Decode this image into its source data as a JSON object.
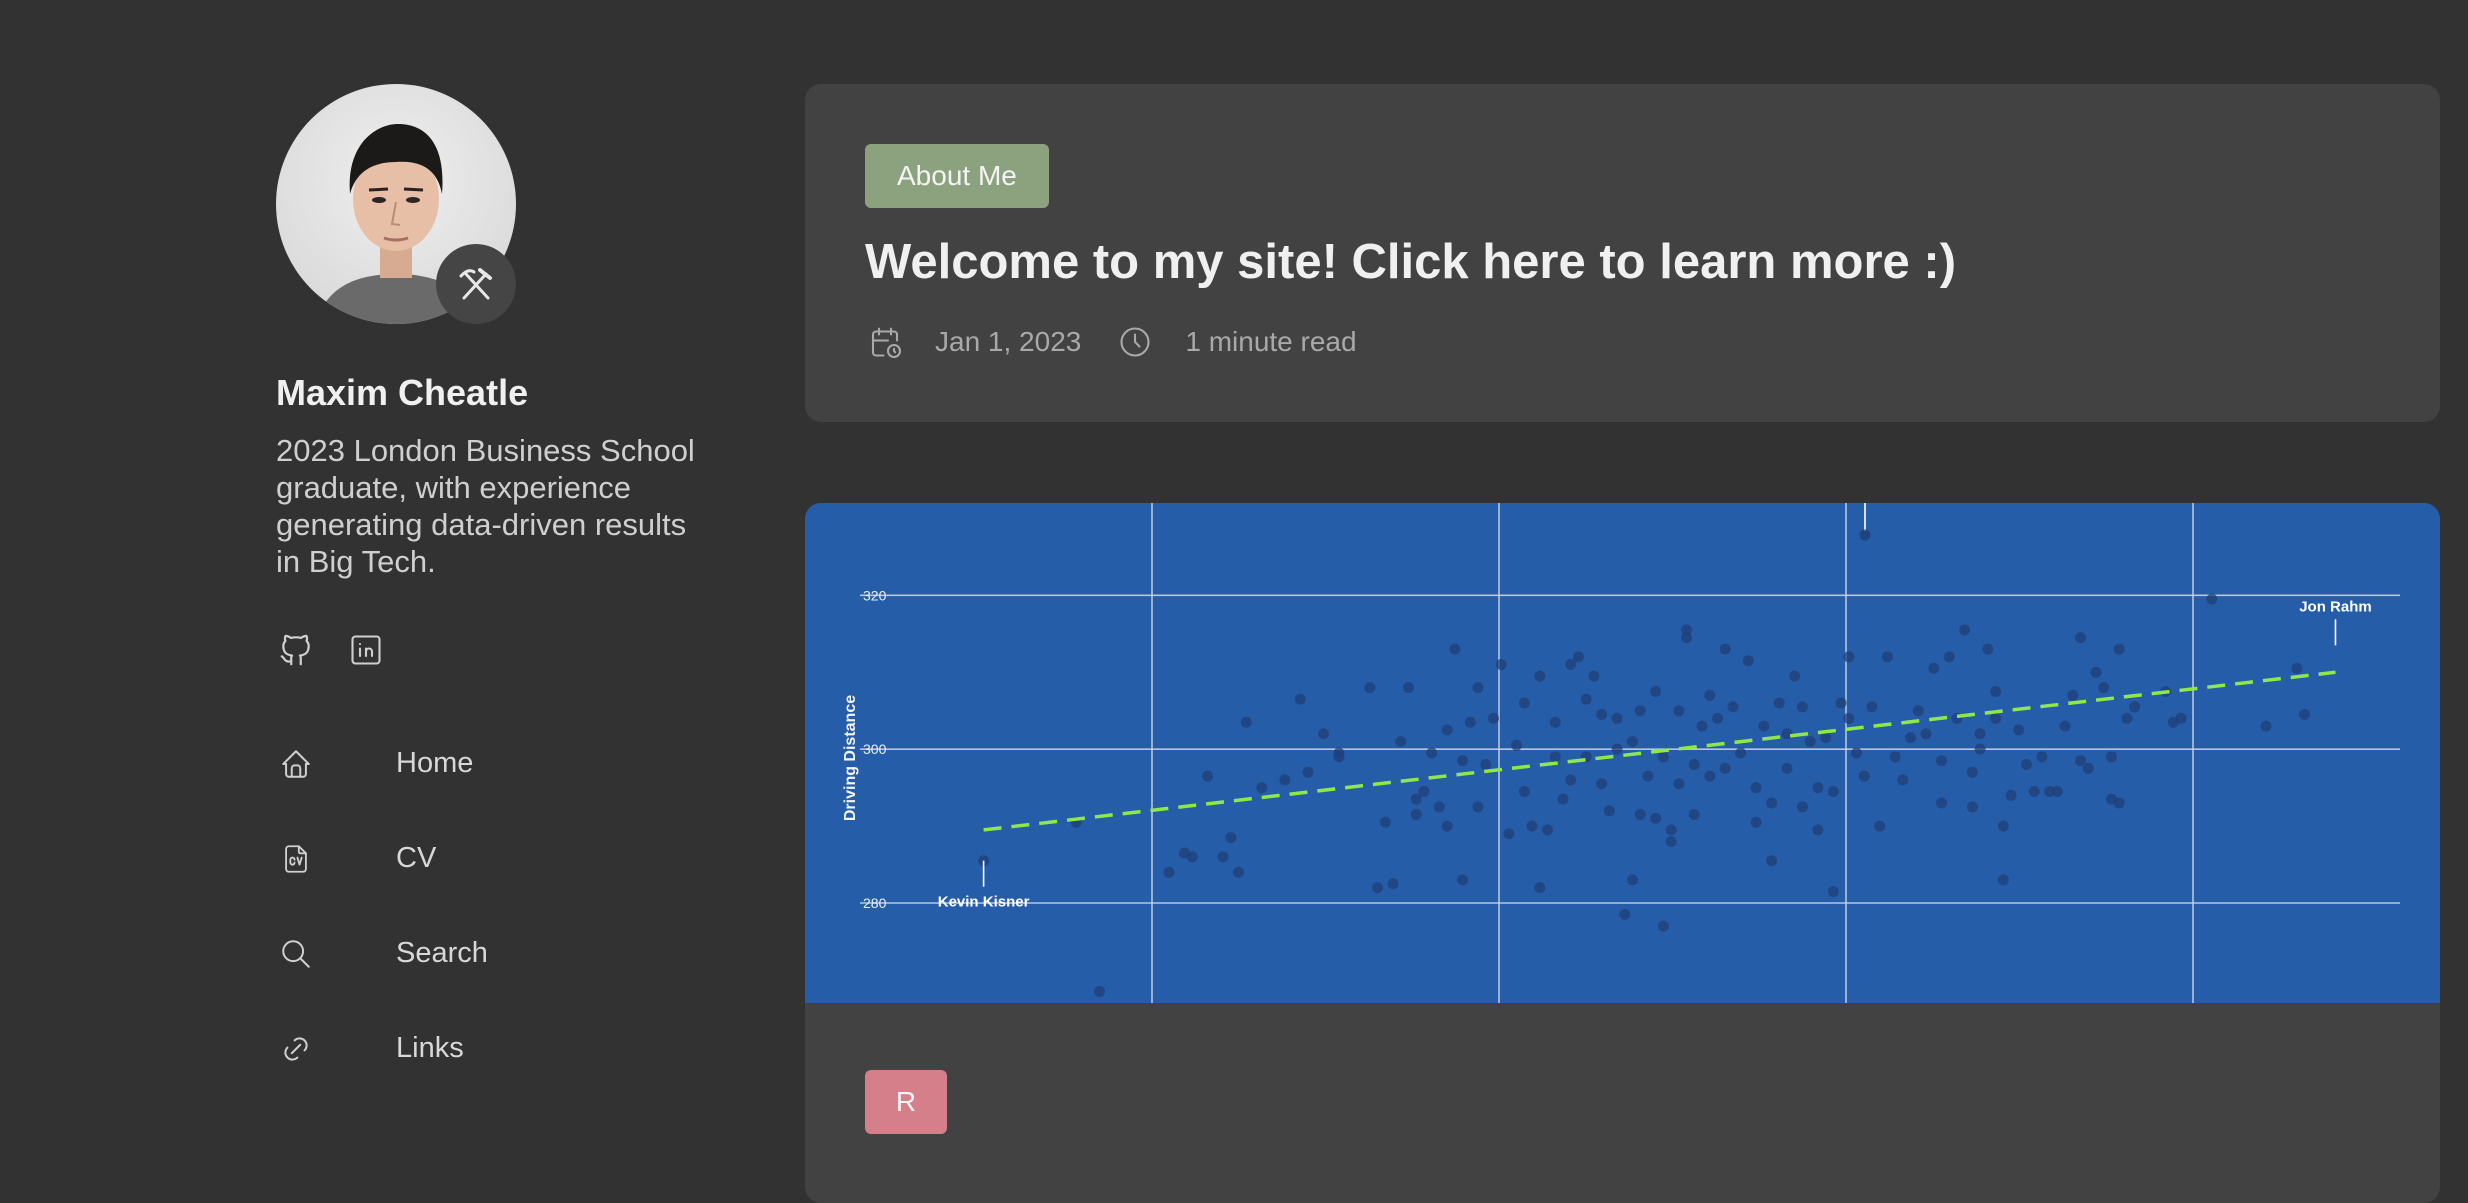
{
  "author": {
    "name": "Maxim Cheatle",
    "bio": "2023 London Business School graduate, with experience generating data-driven results in Big Tech.",
    "avatar_badge_icon": "hammer-pick-icon"
  },
  "social": [
    {
      "icon": "github-icon"
    },
    {
      "icon": "linkedin-icon"
    }
  ],
  "nav": {
    "items": [
      {
        "label": "Home",
        "icon": "home-icon"
      },
      {
        "label": "CV",
        "icon": "cv-file-icon"
      },
      {
        "label": "Search",
        "icon": "search-icon"
      },
      {
        "label": "Links",
        "icon": "link-icon"
      }
    ]
  },
  "post": {
    "tag": "About Me",
    "title": "Welcome to my site! Click here to learn more :)",
    "date": "Jan 1, 2023",
    "read_time": "1 minute read"
  },
  "post2": {
    "tag": "R"
  },
  "colors": {
    "background": "#323232",
    "card": "#424242",
    "tag_about": "#8ca27e",
    "tag_r": "#d47f89",
    "chart_bg": "#265da8",
    "trend_line": "#8fe84a"
  },
  "chart_data": {
    "type": "scatter",
    "ylabel": "Driving Distance",
    "ylim": [
      267,
      332
    ],
    "yticks": [
      280,
      300,
      320
    ],
    "xlim": [
      0,
      1
    ],
    "grid": true,
    "annotations": [
      {
        "label": "Kevin Kisner",
        "x": 0.08,
        "y": 285.5
      },
      {
        "label": "Jon Rahm",
        "x": 0.955,
        "y": 313.5
      }
    ],
    "trend": {
      "x": [
        0.08,
        0.955
      ],
      "y": [
        289.5,
        310
      ]
    },
    "points": [
      [
        0.08,
        285.5
      ],
      [
        0.14,
        290.5
      ],
      [
        0.155,
        268.5
      ],
      [
        0.2,
        284
      ],
      [
        0.21,
        286.5
      ],
      [
        0.215,
        286
      ],
      [
        0.225,
        296.5
      ],
      [
        0.235,
        286
      ],
      [
        0.24,
        288.5
      ],
      [
        0.245,
        284
      ],
      [
        0.25,
        303.5
      ],
      [
        0.26,
        295
      ],
      [
        0.275,
        296
      ],
      [
        0.285,
        306.5
      ],
      [
        0.29,
        297
      ],
      [
        0.3,
        302
      ],
      [
        0.31,
        299.5
      ],
      [
        0.31,
        299
      ],
      [
        0.33,
        308
      ],
      [
        0.335,
        282
      ],
      [
        0.34,
        290.5
      ],
      [
        0.345,
        282.5
      ],
      [
        0.35,
        301
      ],
      [
        0.355,
        308
      ],
      [
        0.36,
        291.5
      ],
      [
        0.36,
        293.5
      ],
      [
        0.365,
        294.5
      ],
      [
        0.37,
        299.5
      ],
      [
        0.375,
        292.5
      ],
      [
        0.38,
        290
      ],
      [
        0.38,
        302.5
      ],
      [
        0.385,
        313
      ],
      [
        0.39,
        298.5
      ],
      [
        0.39,
        283
      ],
      [
        0.395,
        303.5
      ],
      [
        0.4,
        308
      ],
      [
        0.4,
        292.5
      ],
      [
        0.405,
        298
      ],
      [
        0.41,
        304
      ],
      [
        0.415,
        311
      ],
      [
        0.42,
        289
      ],
      [
        0.425,
        300.5
      ],
      [
        0.43,
        306
      ],
      [
        0.43,
        294.5
      ],
      [
        0.435,
        290
      ],
      [
        0.44,
        282
      ],
      [
        0.44,
        309.5
      ],
      [
        0.445,
        289.5
      ],
      [
        0.45,
        303.5
      ],
      [
        0.45,
        299
      ],
      [
        0.455,
        293.5
      ],
      [
        0.46,
        311
      ],
      [
        0.46,
        296
      ],
      [
        0.465,
        312
      ],
      [
        0.47,
        306.5
      ],
      [
        0.47,
        299
      ],
      [
        0.475,
        309.5
      ],
      [
        0.48,
        295.5
      ],
      [
        0.48,
        304.5
      ],
      [
        0.485,
        292
      ],
      [
        0.49,
        300
      ],
      [
        0.49,
        304
      ],
      [
        0.495,
        278.5
      ],
      [
        0.5,
        283
      ],
      [
        0.5,
        301
      ],
      [
        0.505,
        305
      ],
      [
        0.505,
        291.5
      ],
      [
        0.51,
        296.5
      ],
      [
        0.515,
        291
      ],
      [
        0.515,
        307.5
      ],
      [
        0.52,
        277
      ],
      [
        0.52,
        299
      ],
      [
        0.525,
        288
      ],
      [
        0.525,
        289.5
      ],
      [
        0.53,
        305
      ],
      [
        0.53,
        295.5
      ],
      [
        0.535,
        315.5
      ],
      [
        0.535,
        314.5
      ],
      [
        0.54,
        291.5
      ],
      [
        0.54,
        298
      ],
      [
        0.545,
        303
      ],
      [
        0.55,
        307
      ],
      [
        0.55,
        296.5
      ],
      [
        0.555,
        304
      ],
      [
        0.56,
        313
      ],
      [
        0.56,
        297.5
      ],
      [
        0.565,
        305.5
      ],
      [
        0.57,
        299.5
      ],
      [
        0.575,
        311.5
      ],
      [
        0.58,
        295
      ],
      [
        0.58,
        290.5
      ],
      [
        0.585,
        303
      ],
      [
        0.59,
        293
      ],
      [
        0.59,
        285.5
      ],
      [
        0.595,
        306
      ],
      [
        0.6,
        302
      ],
      [
        0.6,
        297.5
      ],
      [
        0.605,
        309.5
      ],
      [
        0.61,
        292.5
      ],
      [
        0.61,
        305.5
      ],
      [
        0.615,
        301
      ],
      [
        0.62,
        295
      ],
      [
        0.62,
        289.5
      ],
      [
        0.625,
        301.5
      ],
      [
        0.63,
        294.5
      ],
      [
        0.63,
        281.5
      ],
      [
        0.635,
        306
      ],
      [
        0.64,
        304
      ],
      [
        0.64,
        312
      ],
      [
        0.645,
        299.5
      ],
      [
        0.65,
        296.5
      ],
      [
        0.655,
        305.5
      ],
      [
        0.66,
        290
      ],
      [
        0.665,
        312
      ],
      [
        0.67,
        299
      ],
      [
        0.675,
        296
      ],
      [
        0.68,
        301.5
      ],
      [
        0.685,
        305
      ],
      [
        0.69,
        302
      ],
      [
        0.695,
        310.5
      ],
      [
        0.7,
        293
      ],
      [
        0.7,
        298.5
      ],
      [
        0.705,
        312
      ],
      [
        0.71,
        304
      ],
      [
        0.715,
        315.5
      ],
      [
        0.72,
        292.5
      ],
      [
        0.72,
        297
      ],
      [
        0.725,
        300
      ],
      [
        0.725,
        302
      ],
      [
        0.73,
        313
      ],
      [
        0.735,
        307.5
      ],
      [
        0.735,
        304
      ],
      [
        0.74,
        283
      ],
      [
        0.74,
        290
      ],
      [
        0.745,
        294
      ],
      [
        0.75,
        302.5
      ],
      [
        0.755,
        298
      ],
      [
        0.76,
        294.5
      ],
      [
        0.765,
        299
      ],
      [
        0.77,
        294.5
      ],
      [
        0.775,
        294.5
      ],
      [
        0.78,
        303
      ],
      [
        0.785,
        307
      ],
      [
        0.79,
        298.5
      ],
      [
        0.79,
        314.5
      ],
      [
        0.795,
        297.5
      ],
      [
        0.8,
        310
      ],
      [
        0.805,
        308
      ],
      [
        0.81,
        293.5
      ],
      [
        0.81,
        299
      ],
      [
        0.815,
        293
      ],
      [
        0.815,
        313
      ],
      [
        0.82,
        304
      ],
      [
        0.825,
        305.5
      ],
      [
        0.845,
        307.5
      ],
      [
        0.85,
        303.5
      ],
      [
        0.855,
        304
      ],
      [
        0.875,
        319.5
      ],
      [
        0.91,
        303
      ],
      [
        0.93,
        310.5
      ],
      [
        0.935,
        304.5
      ]
    ]
  }
}
